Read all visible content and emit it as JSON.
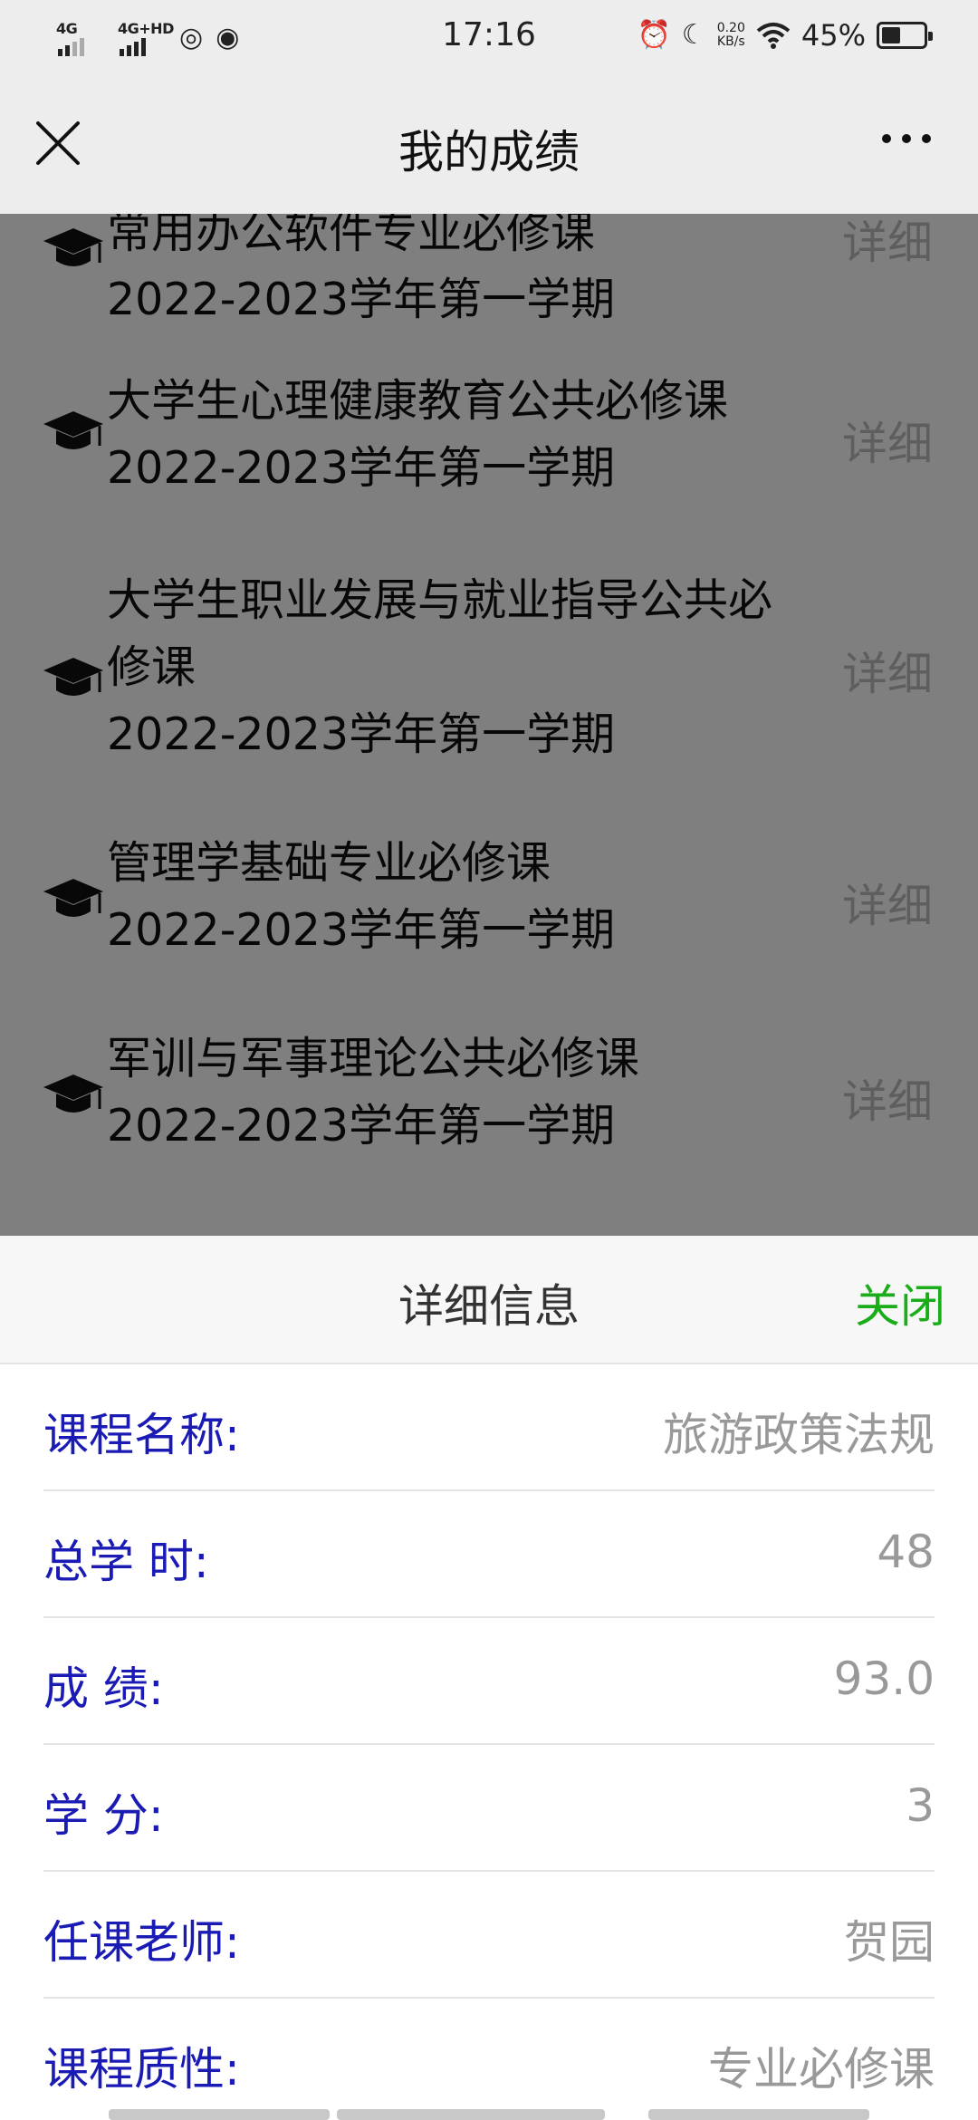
{
  "status_bar": {
    "net1": "4G",
    "net2": "4G+HD",
    "time": "17:16",
    "speed_value": "0.20",
    "speed_unit": "KB/s",
    "battery": "45%",
    "battery_level": 0.45
  },
  "header": {
    "title": "我的成绩"
  },
  "courses": [
    {
      "name": "常用办公软件专业必修课",
      "term": "2022-2023学年第一学期",
      "detail": "详细"
    },
    {
      "name": "大学生心理健康教育公共必修课",
      "term": "2022-2023学年第一学期",
      "detail": "详细"
    },
    {
      "name": "大学生职业发展与就业指导公共必修课",
      "term": "2022-2023学年第一学期",
      "detail": "详细"
    },
    {
      "name": "管理学基础专业必修课",
      "term": "2022-2023学年第一学期",
      "detail": "详细"
    },
    {
      "name": "军训与军事理论公共必修课",
      "term": "2022-2023学年第一学期",
      "detail": "详细"
    }
  ],
  "detail_sheet": {
    "title": "详细信息",
    "close_label": "关闭",
    "rows": [
      {
        "label": "课程名称:",
        "value": "旅游政策法规"
      },
      {
        "label": "总学 时:",
        "value": "48"
      },
      {
        "label": "成 绩:",
        "value": "93.0"
      },
      {
        "label": "学 分:",
        "value": "3"
      },
      {
        "label": "任课老师:",
        "value": "贺园"
      },
      {
        "label": "课程质性:",
        "value": "专业必修课"
      }
    ]
  }
}
